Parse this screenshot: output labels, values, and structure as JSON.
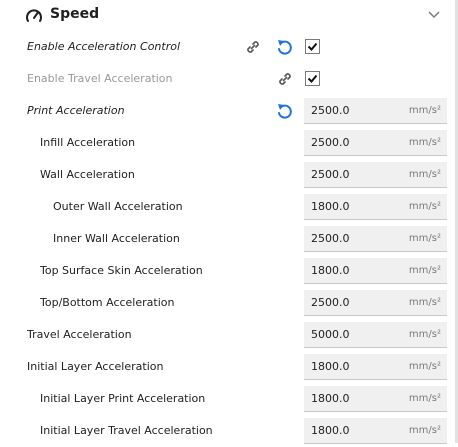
{
  "header": {
    "title": "Speed"
  },
  "rows": [
    {
      "label": "Enable Acceleration Control",
      "checked": true
    },
    {
      "label": "Enable Travel Acceleration",
      "checked": true
    },
    {
      "label": "Print Acceleration",
      "value": "2500.0",
      "unit": "mm/s²"
    },
    {
      "label": "Infill Acceleration",
      "value": "2500.0",
      "unit": "mm/s²"
    },
    {
      "label": "Wall Acceleration",
      "value": "2500.0",
      "unit": "mm/s²"
    },
    {
      "label": "Outer Wall Acceleration",
      "value": "1800.0",
      "unit": "mm/s²"
    },
    {
      "label": "Inner Wall Acceleration",
      "value": "2500.0",
      "unit": "mm/s²"
    },
    {
      "label": "Top Surface Skin Acceleration",
      "value": "1800.0",
      "unit": "mm/s²"
    },
    {
      "label": "Top/Bottom Acceleration",
      "value": "2500.0",
      "unit": "mm/s²"
    },
    {
      "label": "Travel Acceleration",
      "value": "5000.0",
      "unit": "mm/s²"
    },
    {
      "label": "Initial Layer Acceleration",
      "value": "1800.0",
      "unit": "mm/s²"
    },
    {
      "label": "Initial Layer Print Acceleration",
      "value": "1800.0",
      "unit": "mm/s²"
    },
    {
      "label": "Initial Layer Travel Acceleration",
      "value": "1800.0",
      "unit": "mm/s²"
    }
  ],
  "icons": {
    "header": "speedometer-icon",
    "collapse": "chevron-down-icon",
    "link": "link-icon",
    "reset": "reset-icon",
    "check": "checkmark-icon"
  },
  "colors": {
    "reset_blue": "#1f73d6",
    "field_bg": "#f0f0f0",
    "disabled_text": "#9a9a9a"
  }
}
